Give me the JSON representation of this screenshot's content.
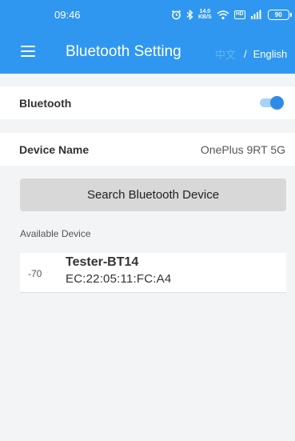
{
  "status_bar": {
    "time": "09:46",
    "net_speed_value": "14.0",
    "net_speed_unit": "KB/S",
    "hd_label": "HD",
    "battery": "90",
    "icons": [
      "alarm-icon",
      "bluetooth-icon",
      "net-speed-indicator",
      "wifi-icon",
      "hd-icon",
      "cell-signal-icon",
      "battery-icon"
    ]
  },
  "app_bar": {
    "menu_icon": "hamburger-menu-icon",
    "title": "Bluetooth Setting",
    "lang_chinese": "中文",
    "lang_separator": "/",
    "lang_english": "English"
  },
  "settings": {
    "bluetooth_label": "Bluetooth",
    "bluetooth_enabled": true,
    "device_name_label": "Device Name",
    "device_name_value": "OnePlus 9RT 5G"
  },
  "search_button_label": "Search Bluetooth Device",
  "available_label": "Available Device",
  "devices": [
    {
      "rssi": "-70",
      "name": "Tester-BT14",
      "mac": "EC:22:05:11:FC:A4"
    }
  ],
  "colors": {
    "primary": "#2f97f0",
    "toggle_on": "#2f8be8",
    "background": "#f3f4f6",
    "button_gray": "#d8d8d8"
  }
}
